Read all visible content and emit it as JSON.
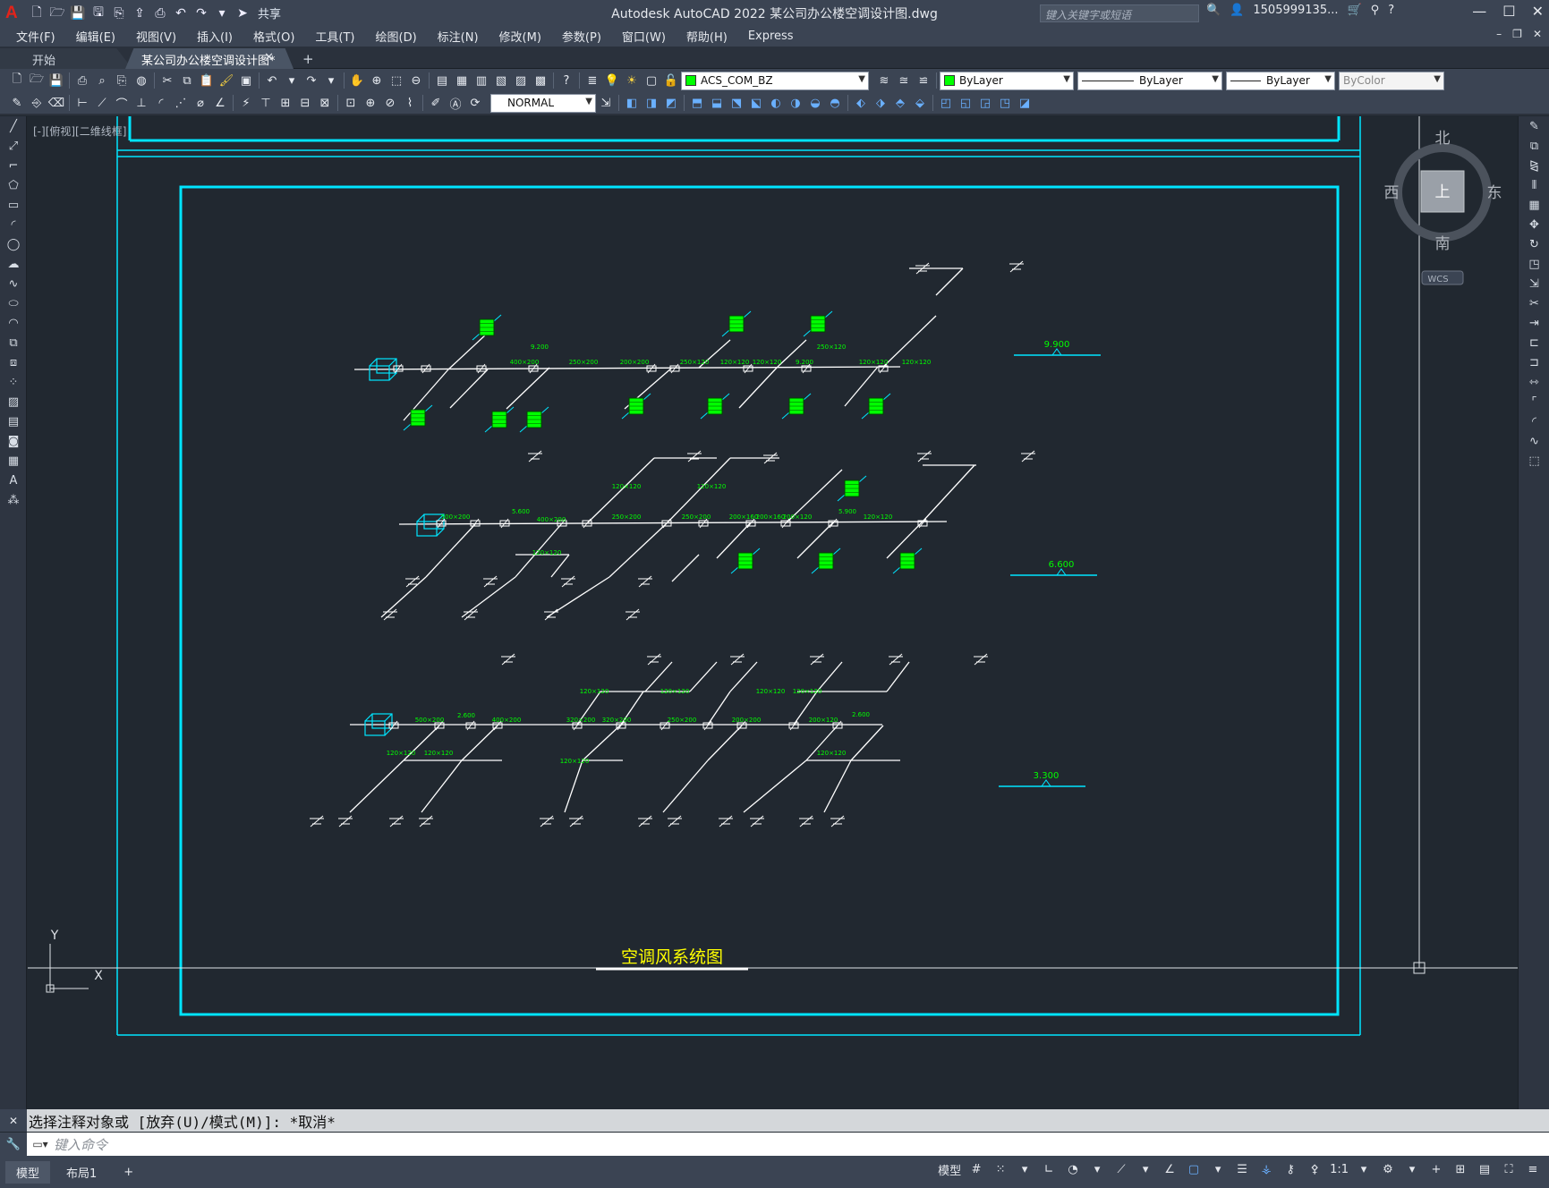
{
  "app": {
    "title": "Autodesk AutoCAD 2022    某公司办公楼空调设计图.dwg",
    "share_label": "共享",
    "search_placeholder": "键入关键字或短语",
    "user": "1505999135...",
    "logo": "A"
  },
  "menu": [
    "文件(F)",
    "编辑(E)",
    "视图(V)",
    "插入(I)",
    "格式(O)",
    "工具(T)",
    "绘图(D)",
    "标注(N)",
    "修改(M)",
    "参数(P)",
    "窗口(W)",
    "帮助(H)",
    "Express"
  ],
  "tabs": {
    "start": "开始",
    "doc": "某公司办公楼空调设计图*",
    "add": "+"
  },
  "toolbar": {
    "layer": "ACS_COM_BZ",
    "color": "ByLayer",
    "linetype": "ByLayer",
    "lineweight": "ByLayer",
    "plotstyle": "ByColor",
    "textstyle": "NORMAL"
  },
  "viewport": {
    "label": "[-][俯视][二维线框]",
    "viewcube": {
      "north": "北",
      "south": "南",
      "east": "东",
      "west": "西",
      "top": "上",
      "wcs": "WCS"
    },
    "ucs": {
      "x": "X",
      "y": "Y"
    }
  },
  "drawing": {
    "title": "空调风系统图",
    "elevations": [
      "9.900",
      "6.600",
      "3.300"
    ],
    "labels_top": [
      "400×200",
      "9.200",
      "250×200",
      "200×200",
      "250×120",
      "120×120",
      "120×120",
      "9.200",
      "250×120",
      "120×120",
      "120×120"
    ],
    "labels_mid": [
      "500×200",
      "5.600",
      "400×200",
      "250×200",
      "250×200",
      "200×160",
      "200×160",
      "200×120",
      "5.900",
      "120×120",
      "120×120",
      "120×120",
      "120×120"
    ],
    "labels_bot": [
      "500×200",
      "2.600",
      "400×200",
      "320×200",
      "320×200",
      "250×200",
      "200×200",
      "200×120",
      "2.600",
      "120×120",
      "120×120",
      "120×120",
      "120×120",
      "120×120",
      "120×120",
      "120×120",
      "120×120"
    ]
  },
  "command": {
    "history": "选择注释对象或 [放弃(U)/模式(M)]: *取消*",
    "placeholder": "键入命令"
  },
  "status": {
    "model_tab": "模型",
    "layout_tab": "布局1",
    "model_space": "模型",
    "scale": "1:1"
  },
  "colors": {
    "background": "#212830",
    "frame": "#00e5ff",
    "duct": "#ffffff",
    "annotation": "#00ff00",
    "title_text": "#ffff00"
  }
}
